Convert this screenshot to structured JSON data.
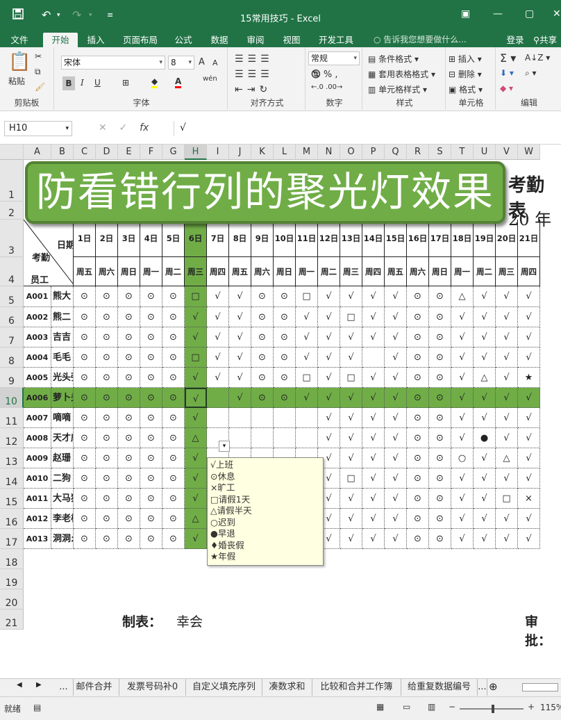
{
  "window": {
    "title": "15常用技巧 - Excel"
  },
  "menu": {
    "tabs": [
      "文件",
      "开始",
      "插入",
      "页面布局",
      "公式",
      "数据",
      "审阅",
      "视图",
      "开发工具"
    ],
    "active": "开始",
    "tellme": "告诉我您想要做什么...",
    "login": "登录",
    "share": "共享"
  },
  "ribbon": {
    "clipboard": {
      "title": "剪贴板",
      "paste": "粘贴"
    },
    "font": {
      "title": "字体",
      "name": "宋体",
      "size": "8",
      "bold": "B",
      "italic": "I",
      "underline": "U",
      "wen": "wén",
      "grow": "A",
      "shrink": "A"
    },
    "align": {
      "title": "对齐方式"
    },
    "number": {
      "title": "数字",
      "format": "常规"
    },
    "styles": {
      "title": "样式",
      "cond": "条件格式",
      "table": "套用表格格式",
      "cell": "单元格样式"
    },
    "cells": {
      "title": "单元格",
      "insert": "插入",
      "delete": "删除",
      "format": "格式"
    },
    "edit": {
      "title": "编辑"
    }
  },
  "formula": {
    "namebox": "H10",
    "value": "√"
  },
  "columns": [
    "A",
    "B",
    "C",
    "D",
    "E",
    "F",
    "G",
    "H",
    "I",
    "J",
    "K",
    "L",
    "M",
    "N",
    "O",
    "P",
    "Q",
    "R",
    "S",
    "T",
    "U",
    "V",
    "W"
  ],
  "rows": [
    "1",
    "2",
    "3",
    "4",
    "5",
    "6",
    "7",
    "8",
    "9",
    "10",
    "11",
    "12",
    "13",
    "14",
    "15",
    "16",
    "17",
    "18",
    "19",
    "20",
    "21"
  ],
  "selected": {
    "col": "H",
    "row": "10"
  },
  "sheet": {
    "banner": "防看错行列的聚光灯效果",
    "kq_title": "考勤表",
    "year": "20 年",
    "hdr_date": "日期",
    "hdr_att": "考勤",
    "hdr_emp": "员工",
    "days": [
      "1日",
      "2日",
      "3日",
      "4日",
      "5日",
      "6日",
      "7日",
      "8日",
      "9日",
      "10日",
      "11日",
      "12日",
      "13日",
      "14日",
      "15日",
      "16日",
      "17日",
      "18日",
      "19日",
      "20日",
      "21日"
    ],
    "weekdays": [
      "周五",
      "周六",
      "周日",
      "周一",
      "周二",
      "周三",
      "周四",
      "周五",
      "周六",
      "周日",
      "周一",
      "周二",
      "周三",
      "周四",
      "周五",
      "周六",
      "周日",
      "周一",
      "周二",
      "周三",
      "周四"
    ],
    "employees": [
      {
        "id": "A001",
        "name": "熊大",
        "marks": [
          "⊙",
          "⊙",
          "⊙",
          "⊙",
          "⊙",
          "□",
          "√",
          "√",
          "⊙",
          "⊙",
          "□",
          "√",
          "√",
          "√",
          "√",
          "⊙",
          "⊙",
          "△",
          "√",
          "√",
          "√"
        ]
      },
      {
        "id": "A002",
        "name": "熊二",
        "marks": [
          "⊙",
          "⊙",
          "⊙",
          "⊙",
          "⊙",
          "√",
          "√",
          "√",
          "⊙",
          "⊙",
          "√",
          "√",
          "□",
          "√",
          "√",
          "⊙",
          "⊙",
          "√",
          "√",
          "√",
          "√"
        ]
      },
      {
        "id": "A003",
        "name": "吉吉",
        "marks": [
          "⊙",
          "⊙",
          "⊙",
          "⊙",
          "⊙",
          "√",
          "√",
          "√",
          "⊙",
          "⊙",
          "√",
          "√",
          "√",
          "√",
          "√",
          "⊙",
          "⊙",
          "√",
          "√",
          "√",
          "√"
        ]
      },
      {
        "id": "A004",
        "name": "毛毛",
        "marks": [
          "⊙",
          "⊙",
          "⊙",
          "⊙",
          "⊙",
          "□",
          "√",
          "√",
          "⊙",
          "⊙",
          "√",
          "√",
          "√",
          "",
          "√",
          "⊙",
          "⊙",
          "√",
          "√",
          "√",
          "√"
        ]
      },
      {
        "id": "A005",
        "name": "光头强",
        "marks": [
          "⊙",
          "⊙",
          "⊙",
          "⊙",
          "⊙",
          "√",
          "√",
          "√",
          "⊙",
          "⊙",
          "□",
          "√",
          "□",
          "√",
          "√",
          "⊙",
          "⊙",
          "√",
          "△",
          "√",
          "★"
        ]
      },
      {
        "id": "A006",
        "name": "萝卜头",
        "marks": [
          "⊙",
          "⊙",
          "⊙",
          "⊙",
          "⊙",
          "√",
          "",
          "√",
          "⊙",
          "⊙",
          "√",
          "√",
          "√",
          "√",
          "√",
          "⊙",
          "⊙",
          "√",
          "√",
          "√",
          "√"
        ]
      },
      {
        "id": "A007",
        "name": "嘀嘀",
        "marks": [
          "⊙",
          "⊙",
          "⊙",
          "⊙",
          "⊙",
          "√",
          "",
          "",
          "",
          "",
          "",
          "√",
          "√",
          "√",
          "√",
          "⊙",
          "⊙",
          "√",
          "√",
          "√",
          "√"
        ]
      },
      {
        "id": "A008",
        "name": "天才威",
        "marks": [
          "⊙",
          "⊙",
          "⊙",
          "⊙",
          "⊙",
          "△",
          "",
          "",
          "",
          "",
          "",
          "√",
          "√",
          "√",
          "√",
          "⊙",
          "⊙",
          "√",
          "●",
          "√",
          "√"
        ]
      },
      {
        "id": "A009",
        "name": "赵珊",
        "marks": [
          "⊙",
          "⊙",
          "⊙",
          "⊙",
          "⊙",
          "√",
          "",
          "",
          "",
          "",
          "",
          "√",
          "√",
          "√",
          "√",
          "⊙",
          "⊙",
          "○",
          "√",
          "△",
          "√"
        ]
      },
      {
        "id": "A010",
        "name": "二狗",
        "marks": [
          "⊙",
          "⊙",
          "⊙",
          "⊙",
          "⊙",
          "√",
          "",
          "",
          "",
          "",
          "",
          "√",
          "□",
          "√",
          "√",
          "⊙",
          "⊙",
          "√",
          "√",
          "√",
          "√"
        ]
      },
      {
        "id": "A011",
        "name": "大马猴",
        "marks": [
          "⊙",
          "⊙",
          "⊙",
          "⊙",
          "⊙",
          "√",
          "",
          "",
          "",
          "",
          "□",
          "√",
          "√",
          "√",
          "√",
          "⊙",
          "⊙",
          "√",
          "√",
          "□",
          "×"
        ]
      },
      {
        "id": "A012",
        "name": "李老板",
        "marks": [
          "⊙",
          "⊙",
          "⊙",
          "⊙",
          "⊙",
          "△",
          "",
          "",
          "",
          "",
          "",
          "√",
          "√",
          "√",
          "√",
          "⊙",
          "⊙",
          "√",
          "√",
          "√",
          "√"
        ]
      },
      {
        "id": "A013",
        "name": "洞洞幺",
        "marks": [
          "⊙",
          "⊙",
          "⊙",
          "⊙",
          "⊙",
          "√",
          "√",
          "√",
          "⊙",
          "⊙",
          "√",
          "√",
          "√",
          "√",
          "√",
          "⊙",
          "⊙",
          "√",
          "√",
          "√",
          "√"
        ]
      }
    ],
    "maker_label": "制表：",
    "maker_name": "幸会",
    "approve_label": "审批："
  },
  "dropdown": {
    "options": [
      "√上班",
      "⊙休息",
      "×旷工",
      "□请假1天",
      "△请假半天",
      "○迟到",
      "●早退",
      "♦婚丧假",
      "★年假"
    ]
  },
  "sheettabs": [
    "...",
    "邮件合并",
    "发票号码补0",
    "自定义填充序列",
    "凑数求和",
    "比较和合并工作簿",
    "给重复数据编号",
    "..."
  ],
  "status": {
    "ready": "就绪",
    "zoom": "115%"
  },
  "colors": {
    "excel_green": "#217346",
    "highlight": "#70ad47"
  }
}
